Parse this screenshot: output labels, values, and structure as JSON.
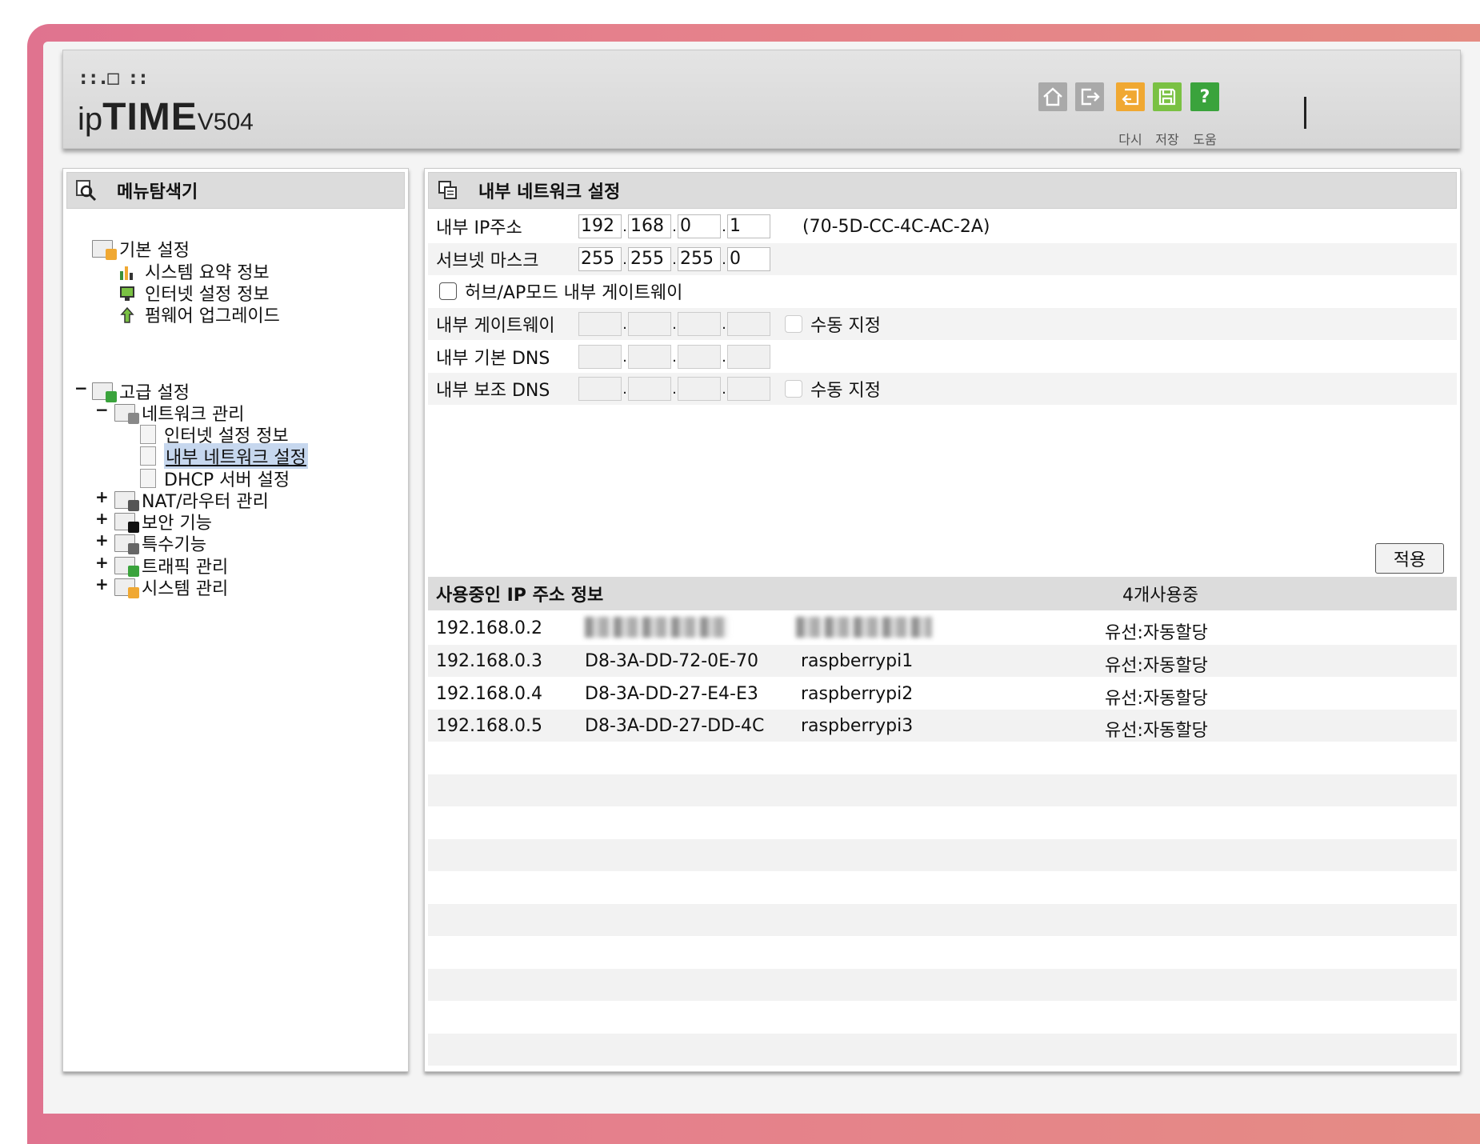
{
  "header": {
    "logo_dots": "::.□ ::",
    "logo_ip": "ip",
    "logo_time": "TIME",
    "logo_model": "V504",
    "buttons": [
      {
        "name": "home-icon"
      },
      {
        "name": "logout-icon"
      },
      {
        "name": "back-icon",
        "label": "다시",
        "color": "#f0a832"
      },
      {
        "name": "save-icon",
        "label": "저장",
        "color": "#7ac143"
      },
      {
        "name": "help-icon",
        "label": "도움",
        "color": "#3aa33c"
      }
    ]
  },
  "menu": {
    "title": "메뉴탐색기",
    "basic": {
      "label": "기본 설정",
      "items": [
        "시스템 요약 정보",
        "인터넷 설정 정보",
        "펌웨어 업그레이드"
      ]
    },
    "advanced": {
      "label": "고급 설정",
      "network": {
        "label": "네트워크 관리",
        "items": [
          "인터넷 설정 정보",
          "내부 네트워크 설정",
          "DHCP 서버 설정"
        ]
      },
      "groups": [
        "NAT/라우터 관리",
        "보안 기능",
        "특수기능",
        "트래픽 관리",
        "시스템 관리"
      ]
    },
    "expand_sign": "+",
    "collapse_sign": "−"
  },
  "form": {
    "title": "내부 네트워크 설정",
    "ip_label": "내부 IP주소",
    "ip": [
      "192",
      "168",
      "0",
      "1"
    ],
    "mac": "(70-5D-CC-4C-AC-2A)",
    "subnet_label": "서브넷 마스크",
    "subnet": [
      "255",
      "255",
      "255",
      "0"
    ],
    "hub_label": "허브/AP모드 내부 게이트웨이",
    "gateway_label": "내부 게이트웨이",
    "manual_label": "수동 지정",
    "dns1_label": "내부 기본 DNS",
    "dns2_label": "내부 보조 DNS",
    "octet_sep": ".",
    "apply": "적용"
  },
  "table": {
    "title": "사용중인 IP 주소 정보",
    "count": "4개사용중",
    "rows": [
      {
        "ip": "192.168.0.2",
        "mac": "",
        "name": "",
        "type": "유선:자동할당"
      },
      {
        "ip": "192.168.0.3",
        "mac": "D8-3A-DD-72-0E-70",
        "name": "raspberrypi1",
        "type": "유선:자동할당"
      },
      {
        "ip": "192.168.0.4",
        "mac": "D8-3A-DD-27-E4-E3",
        "name": "raspberrypi2",
        "type": "유선:자동할당"
      },
      {
        "ip": "192.168.0.5",
        "mac": "D8-3A-DD-27-DD-4C",
        "name": "raspberrypi3",
        "type": "유선:자동할당"
      }
    ]
  }
}
